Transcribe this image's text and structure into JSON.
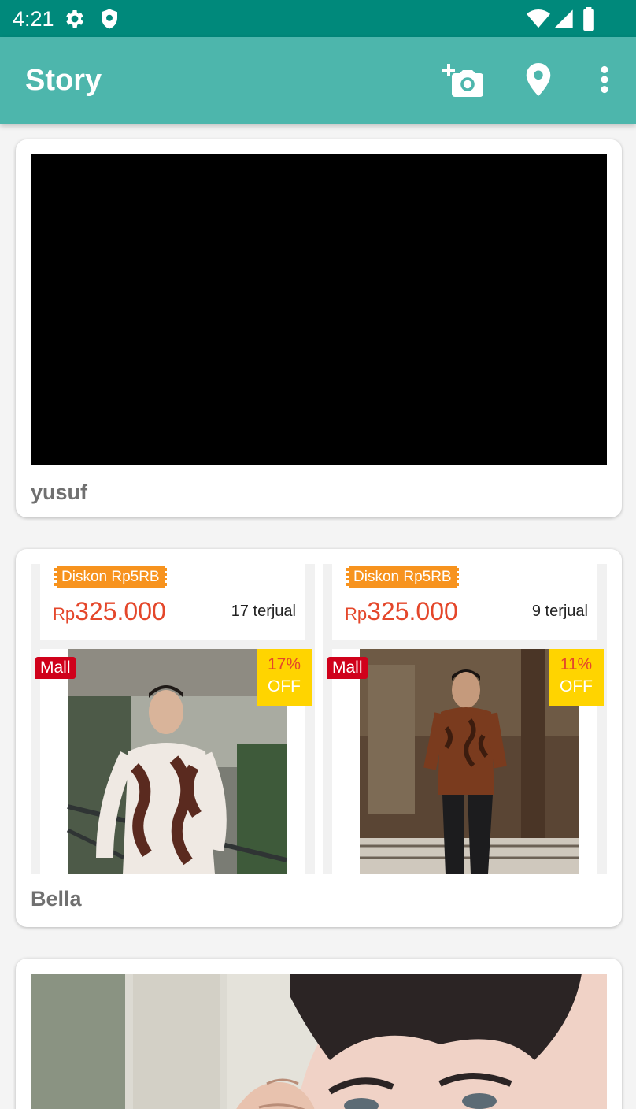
{
  "status_bar": {
    "time": "4:21",
    "icons": [
      "gear-icon",
      "shield-icon",
      "wifi-icon",
      "signal-icon",
      "battery-icon"
    ]
  },
  "app_bar": {
    "title": "Story",
    "actions": [
      "add-photo-icon",
      "location-pin-icon",
      "more-vert-icon"
    ]
  },
  "stories": [
    {
      "name": "yusuf"
    },
    {
      "name": "Bella",
      "products": [
        {
          "discount": "Diskon Rp5RB",
          "currency": "Rp",
          "price": "325.000",
          "sold": "17 terjual",
          "mall": "Mall",
          "off_pct": "17%",
          "off_label": "OFF"
        },
        {
          "discount": "Diskon Rp5RB",
          "currency": "Rp",
          "price": "325.000",
          "sold": "9 terjual",
          "mall": "Mall",
          "off_pct": "11%",
          "off_label": "OFF"
        }
      ]
    },
    {
      "name": ""
    }
  ],
  "colors": {
    "status_bar": "#00897b",
    "app_bar": "#4db6ac",
    "name_text": "#707070",
    "price": "#e4472b",
    "discount_tag": "#f7931e",
    "mall_badge": "#d0011b",
    "off_badge": "#ffd400"
  }
}
